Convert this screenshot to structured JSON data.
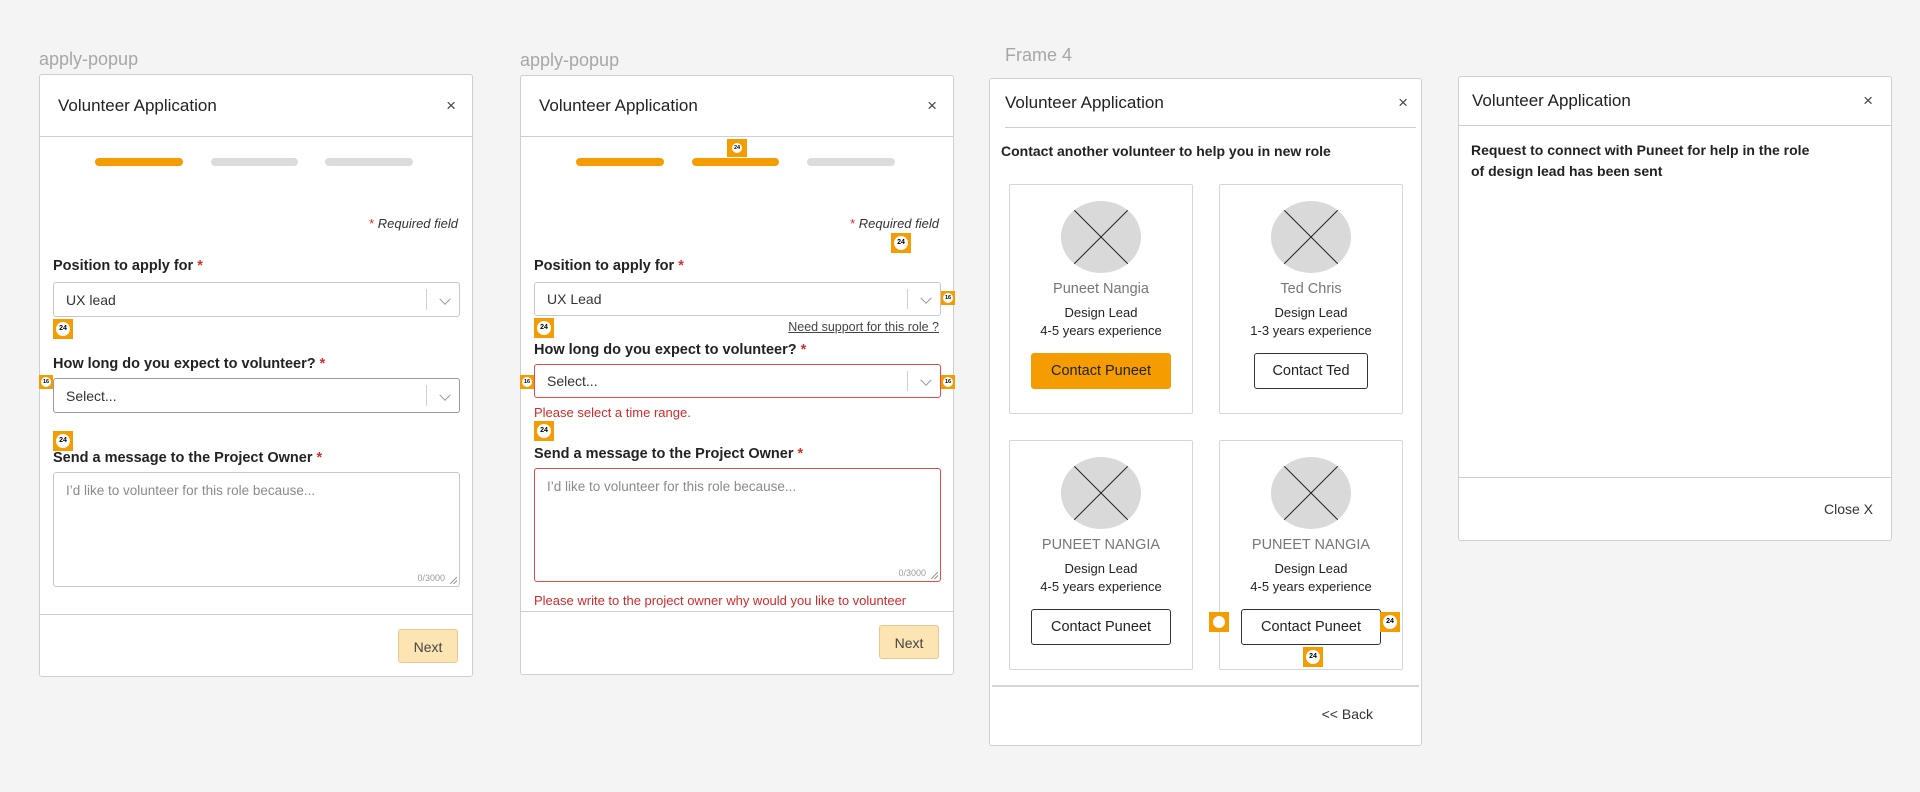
{
  "frames": [
    {
      "label": "apply-popup"
    },
    {
      "label": "apply-popup"
    },
    {
      "label": "Frame 4"
    },
    {
      "label": ""
    }
  ],
  "dialog_title": "Volunteer Application",
  "close_icon": "×",
  "required_note": "Required field",
  "required_star": "*",
  "position_label": "Position to apply for",
  "duration_label": "How long do you expect to volunteer?",
  "message_label": "Send a message to the Project Owner",
  "select_placeholder": "Select...",
  "message_placeholder": "I’d like to volunteer for this role because...",
  "char_count": "0/3000",
  "next_label": "Next",
  "badges": {
    "spacing_24": "24",
    "spacing_16": "16"
  },
  "form1": {
    "position_value": "UX lead"
  },
  "form2": {
    "position_value": "UX Lead",
    "support_link": "Need support for this role ?",
    "duration_error": "Please select a time range.",
    "message_error": "Please write to the project owner why would you like to volunteer"
  },
  "contacts": {
    "intro": "Contact another volunteer to help you in new role",
    "back_label": "<< Back",
    "cards": [
      {
        "name": "Puneet Nangia",
        "role": "Design Lead",
        "exp": "4-5 years experience",
        "button": "Contact Puneet",
        "primary": true
      },
      {
        "name": "Ted Chris",
        "role": "Design Lead",
        "exp": "1-3 years experience",
        "button": "Contact Ted",
        "primary": false
      },
      {
        "name": "PUNEET NANGIA",
        "role": "Design Lead",
        "exp": "4-5 years experience",
        "button": "Contact Puneet",
        "primary": false
      },
      {
        "name": "PUNEET NANGIA",
        "role": "Design Lead",
        "exp": "4-5 years experience",
        "button": "Contact Puneet",
        "primary": false
      }
    ]
  },
  "confirmation": {
    "message": "Request to connect with Puneet for help in the role of design lead has been sent",
    "close_label": "Close X"
  },
  "colors": {
    "accent": "#f59d00",
    "error": "#d32f2f",
    "next_button": "#fde4b3"
  }
}
